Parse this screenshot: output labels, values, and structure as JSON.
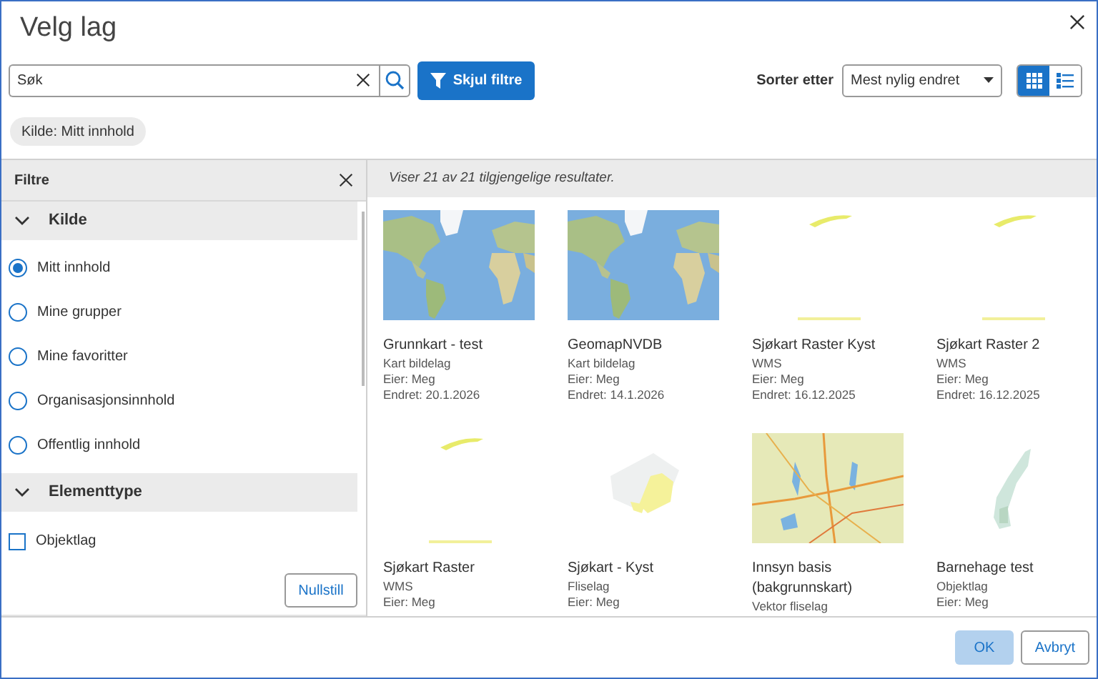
{
  "dialog": {
    "title": "Velg lag"
  },
  "search": {
    "placeholder": "Søk"
  },
  "filter_toggle": {
    "label": "Skjul filtre"
  },
  "sort": {
    "label": "Sorter etter",
    "value": "Mest nylig endret"
  },
  "view_modes": [
    {
      "kind": "grid",
      "selected": true
    },
    {
      "kind": "list",
      "selected": false
    }
  ],
  "active_filters": [
    "Kilde: Mitt innhold"
  ],
  "filters": {
    "title": "Filtre",
    "sections": [
      {
        "title": "Kilde",
        "expanded": true,
        "kind": "radio",
        "options": [
          {
            "label": "Mitt innhold",
            "selected": true
          },
          {
            "label": "Mine grupper",
            "selected": false
          },
          {
            "label": "Mine favoritter",
            "selected": false
          },
          {
            "label": "Organisasjonsinnhold",
            "selected": false
          },
          {
            "label": "Offentlig innhold",
            "selected": false
          }
        ]
      },
      {
        "title": "Elementtype",
        "expanded": true,
        "kind": "checkbox",
        "options": [
          {
            "label": "Objektlag",
            "checked": false
          }
        ]
      }
    ],
    "reset": "Nullstill"
  },
  "results": {
    "status": "Viser 21 av 21 tilgjengelige resultater.",
    "cards": [
      {
        "title": "Grunnkart - test",
        "lines": [
          "Kart bildelag",
          "Eier: Meg",
          "Endret: 20.1.2026"
        ]
      },
      {
        "title": "GeomapNVDB",
        "lines": [
          "Kart bildelag",
          "Eier: Meg",
          "Endret: 14.1.2026"
        ]
      },
      {
        "title": "Sjøkart Raster Kyst",
        "lines": [
          "WMS",
          "Eier: Meg",
          "Endret: 16.12.2025"
        ]
      },
      {
        "title": "Sjøkart Raster 2",
        "lines": [
          "WMS",
          "Eier: Meg",
          "Endret: 16.12.2025"
        ]
      },
      {
        "title": "Sjøkart Raster",
        "lines": [
          "WMS",
          "Eier: Meg"
        ]
      },
      {
        "title": "Sjøkart - Kyst",
        "lines": [
          "Fliselag",
          "Eier: Meg"
        ]
      },
      {
        "title": "Innsyn basis (bakgrunnskart)",
        "lines": [
          "Vektor fliselag"
        ]
      },
      {
        "title": "Barnehage test",
        "lines": [
          "Objektlag",
          "Eier: Meg"
        ]
      }
    ]
  },
  "footer": {
    "buttons": [
      {
        "label": "OK",
        "kind": "primary",
        "disabled": true
      },
      {
        "label": "Avbryt",
        "kind": "secondary",
        "disabled": false
      }
    ]
  }
}
